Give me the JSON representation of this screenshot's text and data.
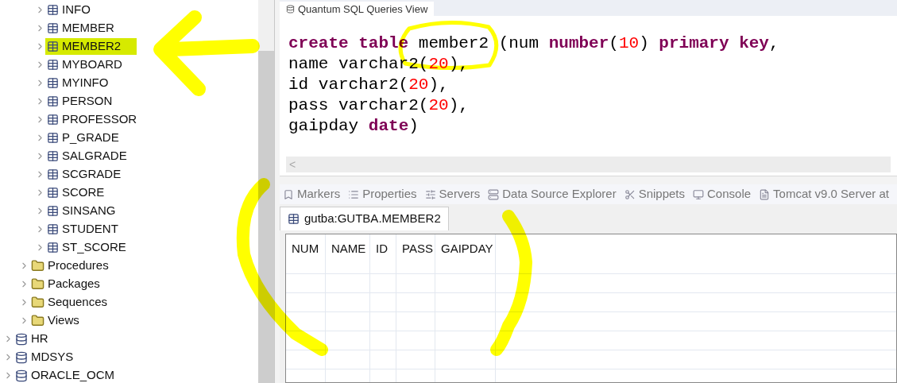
{
  "tree": {
    "items": [
      {
        "children": [
          {
            "children": [
              {
                "label": "INFO",
                "kind": "table",
                "selected": false
              },
              {
                "label": "MEMBER",
                "kind": "table",
                "selected": false
              },
              {
                "label": "MEMBER2",
                "kind": "table",
                "selected": true
              },
              {
                "label": "MYBOARD",
                "kind": "table",
                "selected": false
              },
              {
                "label": "MYINFO",
                "kind": "table",
                "selected": false
              },
              {
                "label": "PERSON",
                "kind": "table",
                "selected": false
              },
              {
                "label": "PROFESSOR",
                "kind": "table",
                "selected": false
              },
              {
                "label": "P_GRADE",
                "kind": "table",
                "selected": false
              },
              {
                "label": "SALGRADE",
                "kind": "table",
                "selected": false
              },
              {
                "label": "SCGRADE",
                "kind": "table",
                "selected": false
              },
              {
                "label": "SCORE",
                "kind": "table",
                "selected": false
              },
              {
                "label": "SINSANG",
                "kind": "table",
                "selected": false
              },
              {
                "label": "STUDENT",
                "kind": "table",
                "selected": false
              },
              {
                "label": "ST_SCORE",
                "kind": "table",
                "selected": false
              }
            ]
          },
          {
            "label": "Procedures",
            "kind": "folder",
            "selected": false
          },
          {
            "label": "Packages",
            "kind": "folder",
            "selected": false
          },
          {
            "label": "Sequences",
            "kind": "folder",
            "selected": false
          },
          {
            "label": "Views",
            "kind": "folder",
            "selected": false
          }
        ]
      },
      {
        "label": "HR",
        "kind": "schema",
        "selected": false
      },
      {
        "label": "MDSYS",
        "kind": "schema",
        "selected": false
      },
      {
        "label": "ORACLE_OCM",
        "kind": "schema",
        "selected": false
      }
    ]
  },
  "editor": {
    "tab": "Quantum SQL Queries View",
    "lines": [
      [
        {
          "t": "create table",
          "kind": "keyword"
        },
        {
          "t": " member2 (num ",
          "kind": "plain"
        },
        {
          "t": "number",
          "kind": "keyword"
        },
        {
          "t": "(",
          "kind": "plain"
        },
        {
          "t": "10",
          "kind": "number"
        },
        {
          "t": ") ",
          "kind": "plain"
        },
        {
          "t": "primary key",
          "kind": "keyword"
        },
        {
          "t": ",",
          "kind": "plain"
        }
      ],
      [
        {
          "t": "name varchar2(",
          "kind": "plain"
        },
        {
          "t": "20",
          "kind": "number"
        },
        {
          "t": "),",
          "kind": "plain"
        }
      ],
      [
        {
          "t": "id varchar2(",
          "kind": "plain"
        },
        {
          "t": "20",
          "kind": "number"
        },
        {
          "t": "),",
          "kind": "plain"
        }
      ],
      [
        {
          "t": "pass varchar2(",
          "kind": "plain"
        },
        {
          "t": "20",
          "kind": "number"
        },
        {
          "t": "),",
          "kind": "plain"
        }
      ],
      [
        {
          "t": "gaipday ",
          "kind": "plain"
        },
        {
          "t": "date",
          "kind": "keyword"
        },
        {
          "t": ")",
          "kind": "plain"
        }
      ]
    ],
    "scroll_arrow": "<"
  },
  "bottom_tabs": [
    {
      "label": "Markers"
    },
    {
      "label": "Properties"
    },
    {
      "label": "Servers"
    },
    {
      "label": "Data Source Explorer"
    },
    {
      "label": "Snippets"
    },
    {
      "label": "Console"
    },
    {
      "label": "Tomcat v9.0 Server at"
    }
  ],
  "result": {
    "tab": "gutba:GUTBA.MEMBER2",
    "columns": [
      "NUM",
      "NAME",
      "ID",
      "PASS",
      "GAIPDAY"
    ]
  }
}
